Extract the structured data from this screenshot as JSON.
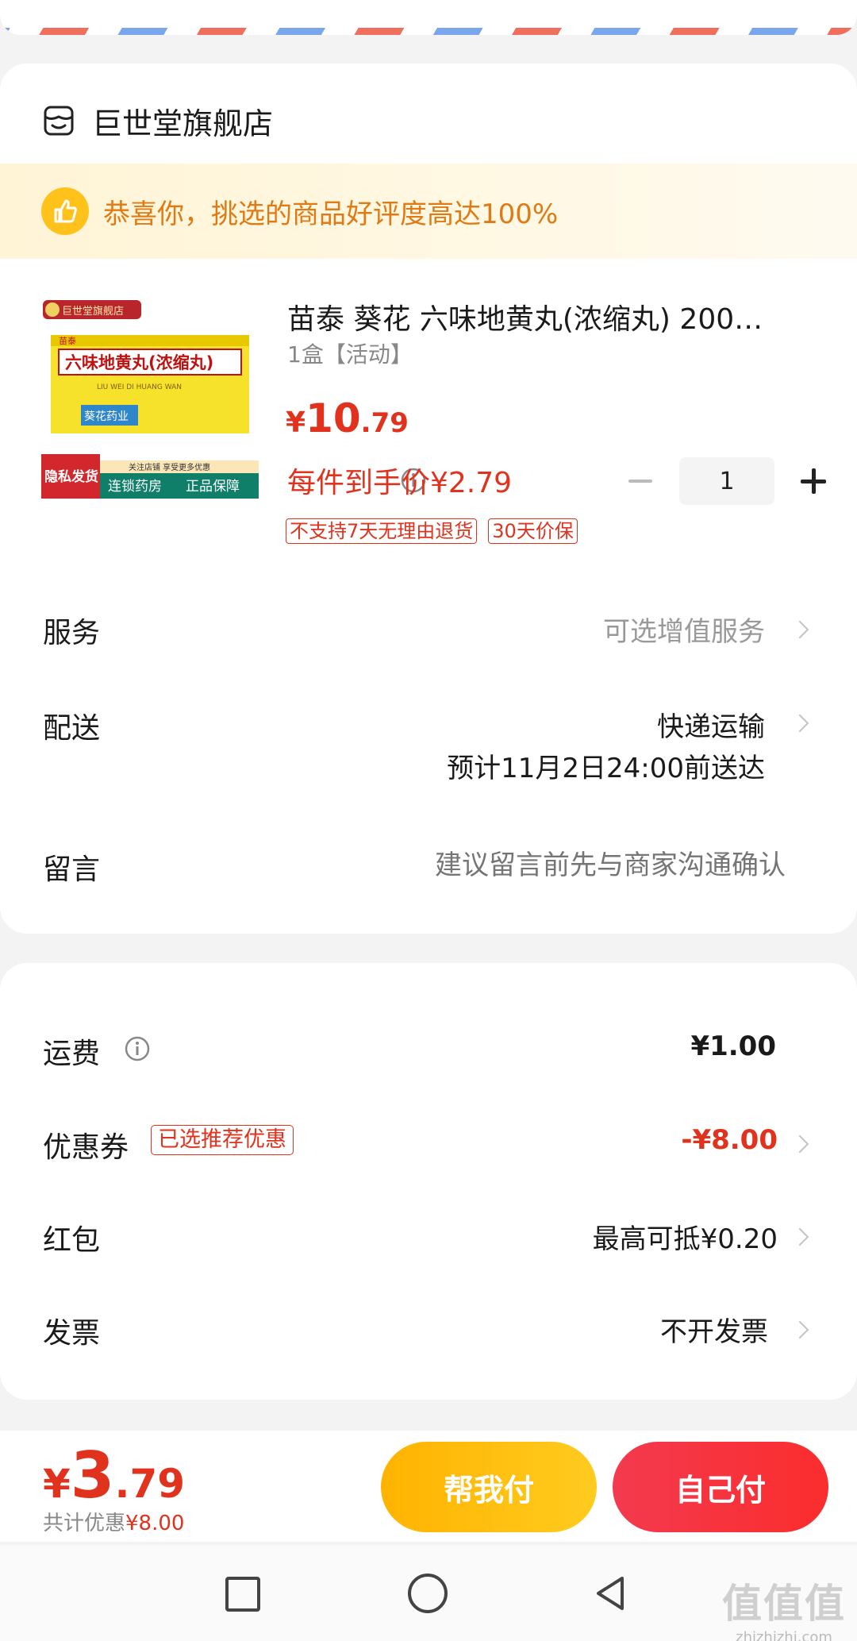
{
  "shop": {
    "name": "巨世堂旗舰店"
  },
  "praise": {
    "text": "恭喜你，挑选的商品好评度高达100%"
  },
  "product": {
    "image_badge_shop": "巨世堂旗舰店",
    "image_brand": "苗泰",
    "image_box_title": "六味地黄丸(浓缩丸)",
    "image_box_pinyin": "LIU WEI DI HUANG WAN",
    "image_box_maker": "葵花药业",
    "image_privacy": "隐私发货",
    "image_follow": "关注店铺 享受更多优惠",
    "image_chain": "连锁药房",
    "image_genuine": "正品保障",
    "title": "苗泰 葵花 六味地黄丸(浓缩丸) 200…",
    "spec": "1盒【活动】",
    "price_yen": "¥",
    "price_int": "10",
    "price_dec": ".79",
    "quantity": "1",
    "unit_price": "每件到手价¥2.79",
    "tags": [
      "不支持7天无理由退货",
      "30天价保"
    ]
  },
  "rows": {
    "service_label": "服务",
    "service_value": "可选增值服务",
    "delivery_label": "配送",
    "delivery_value": "快递运输",
    "delivery_eta": "预计11月2日24:00前送达",
    "message_label": "留言",
    "message_placeholder": "建议留言前先与商家沟通确认"
  },
  "fees": {
    "shipping_label": "运费",
    "shipping_value": "¥1.00",
    "coupon_label": "优惠券",
    "coupon_tag": "已选推荐优惠",
    "coupon_value": "-¥8.00",
    "redpacket_label": "红包",
    "redpacket_value": "最高可抵¥0.20",
    "invoice_label": "发票",
    "invoice_value": "不开发票"
  },
  "footer": {
    "total_yen": "¥",
    "total_int": "3",
    "total_dec": ".79",
    "saved_label": "共计优惠",
    "saved_amount": "¥8.00",
    "help_pay": "帮我付",
    "self_pay": "自己付"
  },
  "watermark": {
    "big": "值值值",
    "small": "zhizhizhi.com"
  },
  "colors": {
    "accent_red": "#e0321d",
    "accent_orange": "#e07a14",
    "yellow": "#ffc21a"
  }
}
